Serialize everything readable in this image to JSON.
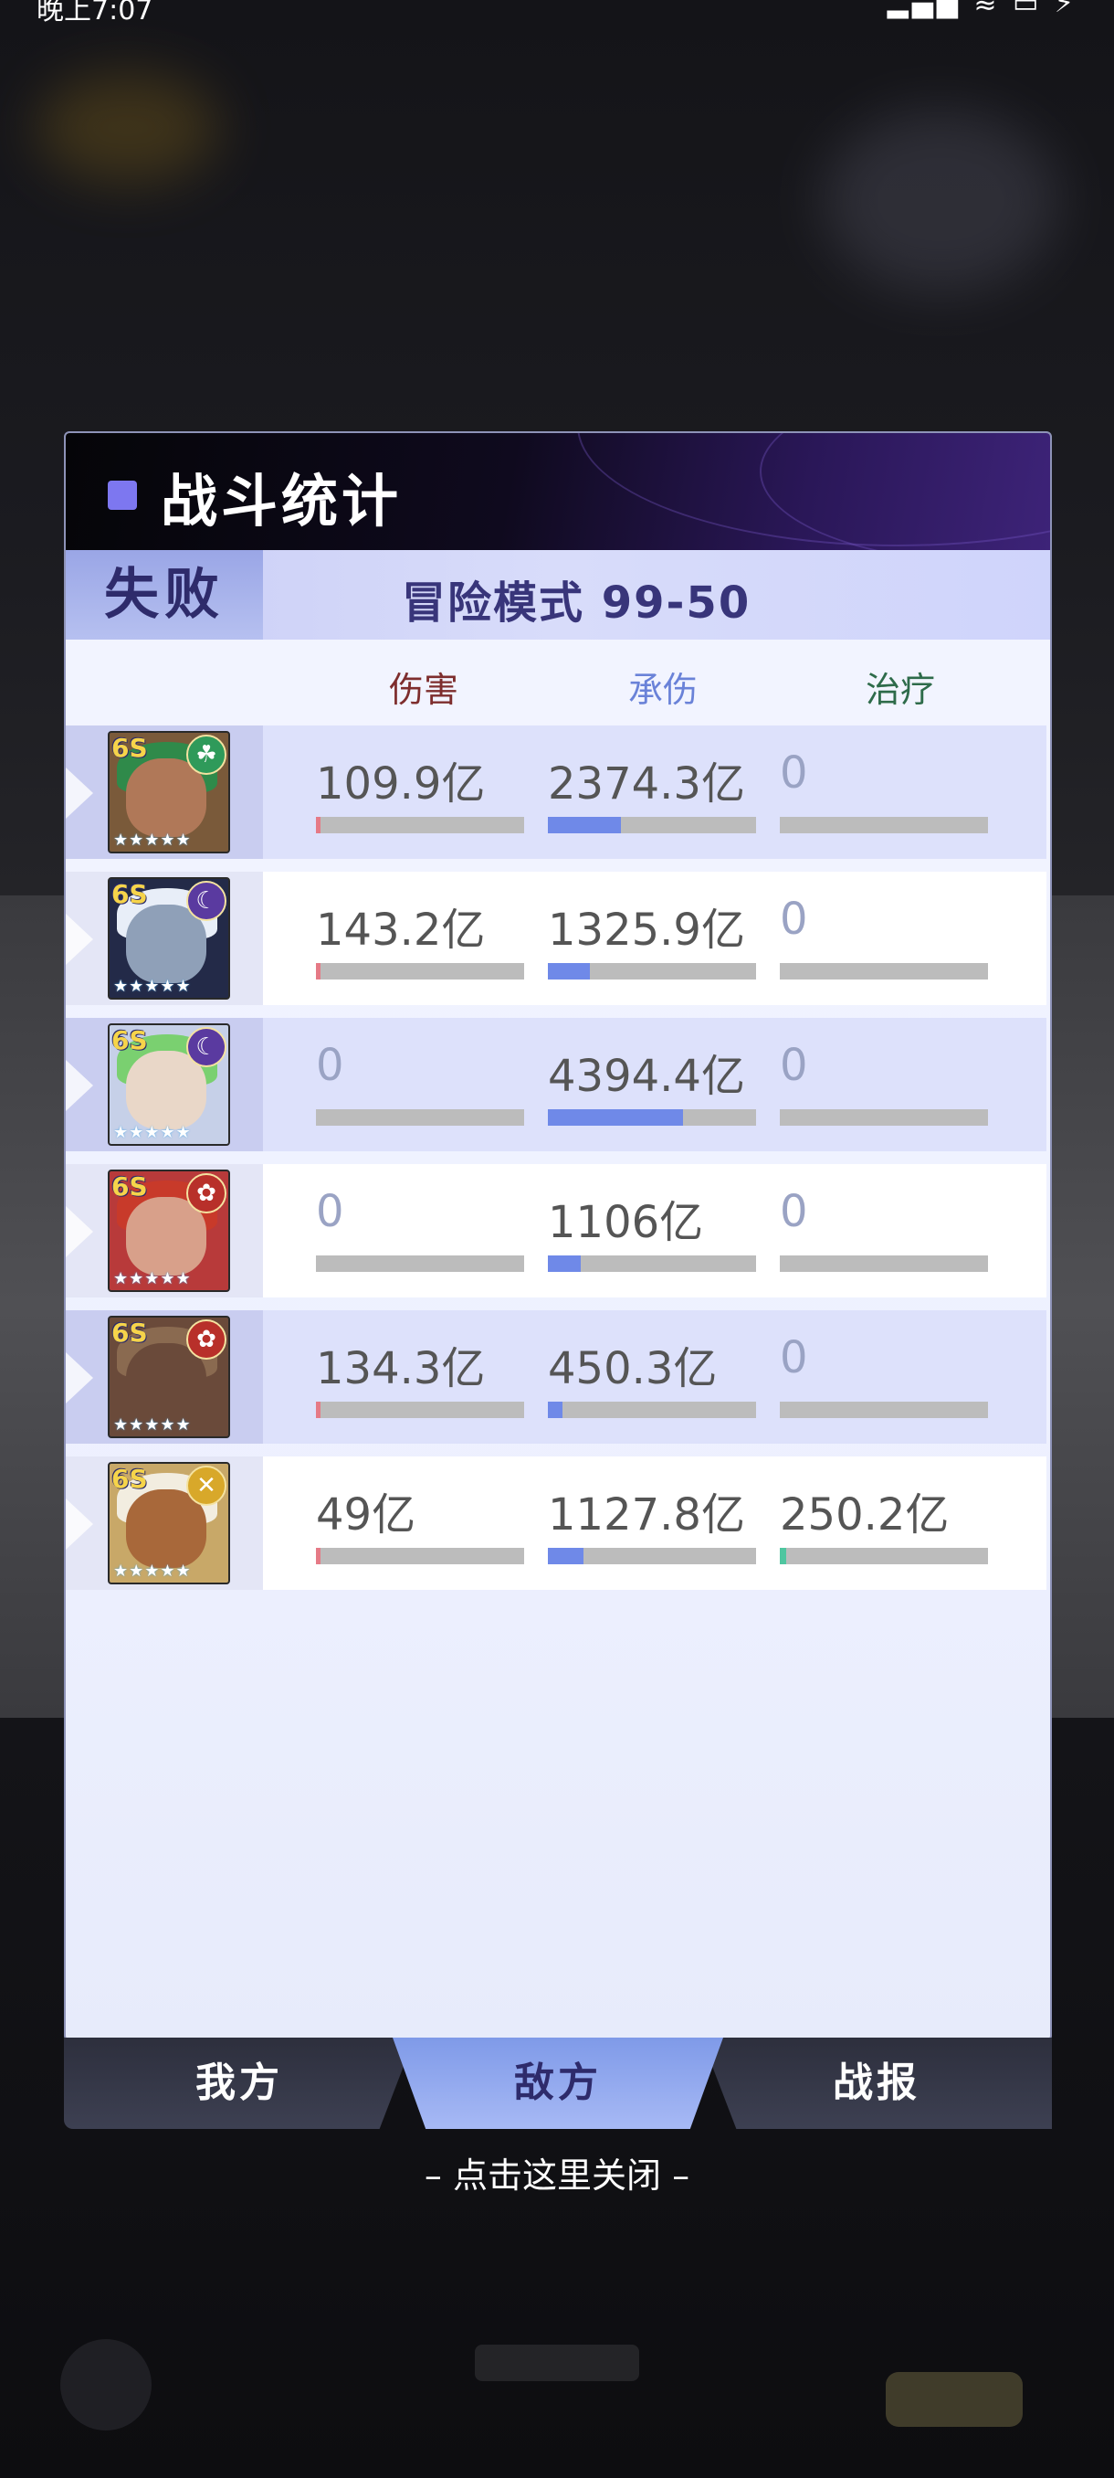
{
  "status_bar": {
    "time": "晚上7:07",
    "icons": "▂▄▆ ≋ ▭ ⚡"
  },
  "panel": {
    "title": "战斗统计",
    "result": "失败",
    "stage": "冒险模式 99-50",
    "columns": {
      "damage": "伤害",
      "tank": "承伤",
      "heal": "治疗"
    }
  },
  "rows": [
    {
      "rank": "6S",
      "faction": "earth",
      "faction_color": "#2f9a5a",
      "damage": "109.9亿",
      "damage_pct": 0.01,
      "tank": "2374.3亿",
      "tank_pct": 0.35,
      "heal": "0",
      "heal_pct": 0
    },
    {
      "rank": "6S",
      "faction": "dark",
      "faction_color": "#5a3aa0",
      "damage": "143.2亿",
      "damage_pct": 0.02,
      "tank": "1325.9亿",
      "tank_pct": 0.2,
      "heal": "0",
      "heal_pct": 0
    },
    {
      "rank": "6S",
      "faction": "dark",
      "faction_color": "#5a3aa0",
      "damage": "0",
      "damage_pct": 0,
      "tank": "4394.4亿",
      "tank_pct": 0.65,
      "heal": "0",
      "heal_pct": 0
    },
    {
      "rank": "6S",
      "faction": "fire",
      "faction_color": "#b8302a",
      "damage": "0",
      "damage_pct": 0,
      "tank": "1106亿",
      "tank_pct": 0.16,
      "heal": "0",
      "heal_pct": 0
    },
    {
      "rank": "6S",
      "faction": "fire",
      "faction_color": "#b8302a",
      "damage": "134.3亿",
      "damage_pct": 0.02,
      "tank": "450.3亿",
      "tank_pct": 0.07,
      "heal": "0",
      "heal_pct": 0
    },
    {
      "rank": "6S",
      "faction": "light",
      "faction_color": "#d8a82a",
      "damage": "49亿",
      "damage_pct": 0.01,
      "tank": "1127.8亿",
      "tank_pct": 0.17,
      "heal": "250.2亿",
      "heal_pct": 0.03
    }
  ],
  "tabs": {
    "ours": "我方",
    "enemy": "敌方",
    "report": "战报"
  },
  "close_hint": "– 点击这里关闭 –",
  "colors": {
    "damage_fill": "#e57a86",
    "tank_fill": "#6f89e8",
    "heal_fill": "#4fc6a0",
    "accent": "#7d77f0"
  }
}
